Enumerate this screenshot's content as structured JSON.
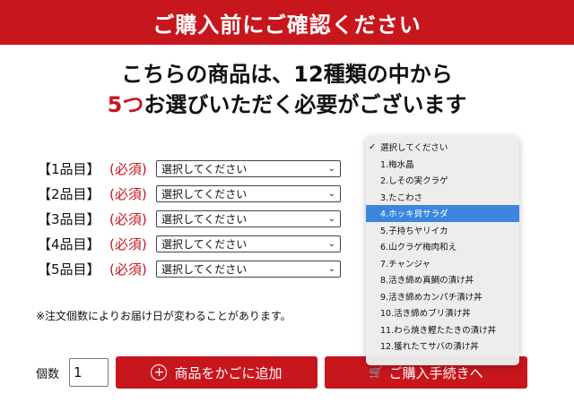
{
  "banner": {
    "text": "ご購入前にご確認ください"
  },
  "headline": {
    "line1": "こちらの商品は、12種類の中から",
    "line2_red": "5つ",
    "line2_rest": "お選びいただく必要がございます"
  },
  "rows": [
    {
      "label": "【1品目】",
      "required": "(必須)",
      "value": "選択してください"
    },
    {
      "label": "【2品目】",
      "required": "(必須)",
      "value": "選択してください"
    },
    {
      "label": "【3品目】",
      "required": "(必須)",
      "value": "選択してください"
    },
    {
      "label": "【4品目】",
      "required": "(必須)",
      "value": "選択してください"
    },
    {
      "label": "【5品目】",
      "required": "(必須)",
      "value": "選択してください"
    }
  ],
  "note": "※注文個数によりお届け日が変わることがあります。",
  "quantity": {
    "label": "個数",
    "value": "1"
  },
  "buttons": {
    "add_to_cart": "商品をかごに追加",
    "proceed": "ご購入手続きへ"
  },
  "dropdown": {
    "options": [
      "選択してください",
      "1.梅水晶",
      "2.しその実クラゲ",
      "3.たこわさ",
      "4.ホッキ貝サラダ",
      "5.子持ちヤリイカ",
      "6.山クラゲ梅肉和え",
      "7.チャンジャ",
      "8.活き締め真鯛の漬け丼",
      "9.活き締めカンパチ漬け丼",
      "10.活き締めブリ漬け丼",
      "11.わら焼き鰹たたきの漬け丼",
      "12.獲れたてサバの漬け丼"
    ],
    "checked_index": 0,
    "highlighted_index": 4
  },
  "colors": {
    "accent": "#c8161d",
    "highlight": "#3d86e0"
  }
}
